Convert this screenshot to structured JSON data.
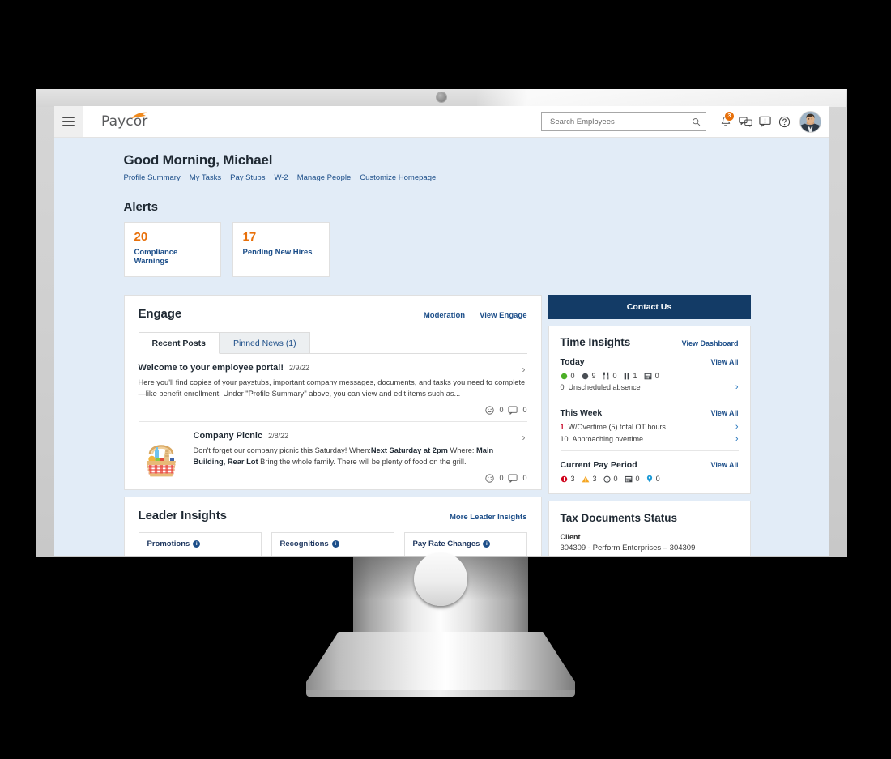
{
  "app": {
    "brand": "Paycor",
    "menu_icon": "hamburger-icon"
  },
  "search": {
    "placeholder": "Search Employees",
    "value": ""
  },
  "header_icons": {
    "notifications_badge": "3",
    "bell": "bell-icon",
    "messages": "messages-icon",
    "feedback": "feedback-icon",
    "help": "help-icon"
  },
  "page": {
    "greeting": "Good Morning, Michael",
    "quick_links": [
      "Profile Summary",
      "My Tasks",
      "Pay Stubs",
      "W-2",
      "Manage People",
      "Customize Homepage"
    ]
  },
  "alerts": {
    "title": "Alerts",
    "cards": [
      {
        "count": "20",
        "label": "Compliance Warnings"
      },
      {
        "count": "17",
        "label": "Pending New Hires"
      }
    ]
  },
  "engage": {
    "title": "Engage",
    "links": [
      "Moderation",
      "View Engage"
    ],
    "tabs": [
      {
        "label": "Recent Posts",
        "active": true
      },
      {
        "label": "Pinned News (1)",
        "active": false
      }
    ],
    "posts": [
      {
        "title": "Welcome to your employee portal!",
        "date": "2/9/22",
        "text_1": "Here you'll find copies of your paystubs, important company messages, documents, and tasks you need to complete—like benefit enrollment. Under \"Profile Summary\" above, you can view and edit items such as...",
        "reactions": "0",
        "comments": "0"
      },
      {
        "title": "Company Picnic",
        "date": "2/8/22",
        "text_1": "Don't forget our company picnic this Saturday! When:",
        "bold_1": "Next Saturday at 2pm",
        "text_2": " Where: ",
        "bold_2": "Main Building, Rear Lot",
        "text_3": " Bring the whole family. There will be plenty of food on the grill.",
        "reactions": "0",
        "comments": "0"
      }
    ]
  },
  "leader_insights": {
    "title": "Leader Insights",
    "link": "More Leader Insights",
    "tiles": [
      "Promotions",
      "Recognitions",
      "Pay Rate Changes"
    ]
  },
  "contact": {
    "label": "Contact Us"
  },
  "time_insights": {
    "title": "Time Insights",
    "dashboard_link": "View Dashboard",
    "sections": [
      {
        "title": "Today",
        "link": "View All",
        "stats": [
          {
            "icon": "green-dot-icon",
            "value": "0"
          },
          {
            "icon": "gray-dot-icon",
            "value": "9"
          },
          {
            "icon": "meal-break-icon",
            "value": "0"
          },
          {
            "icon": "pause-icon",
            "value": "1"
          },
          {
            "icon": "timecard-icon",
            "value": "0"
          }
        ],
        "rows": [
          {
            "num": "0",
            "label": "Unscheduled absence"
          }
        ]
      },
      {
        "title": "This Week",
        "link": "View All",
        "stats": [],
        "rows": [
          {
            "num": "1",
            "label": "W/Overtime (5) total OT hours",
            "inline_num": "5"
          },
          {
            "num": "10",
            "label": "Approaching overtime"
          }
        ]
      },
      {
        "title": "Current Pay Period",
        "link": "View All",
        "stats": [
          {
            "icon": "error-icon",
            "value": "3"
          },
          {
            "icon": "warning-icon",
            "value": "3"
          },
          {
            "icon": "clock-icon",
            "value": "0"
          },
          {
            "icon": "calendar-icon",
            "value": "0"
          },
          {
            "icon": "location-pin-icon",
            "value": "0"
          }
        ],
        "rows": []
      }
    ]
  },
  "tax_documents": {
    "title": "Tax Documents Status",
    "client_label": "Client",
    "client_value": "304309 - Perform Enterprises – 304309"
  },
  "colors": {
    "accent_orange": "#e8700a",
    "link_blue": "#1c4e89",
    "navy": "#133b66",
    "page_bg": "#e2ecf7"
  }
}
